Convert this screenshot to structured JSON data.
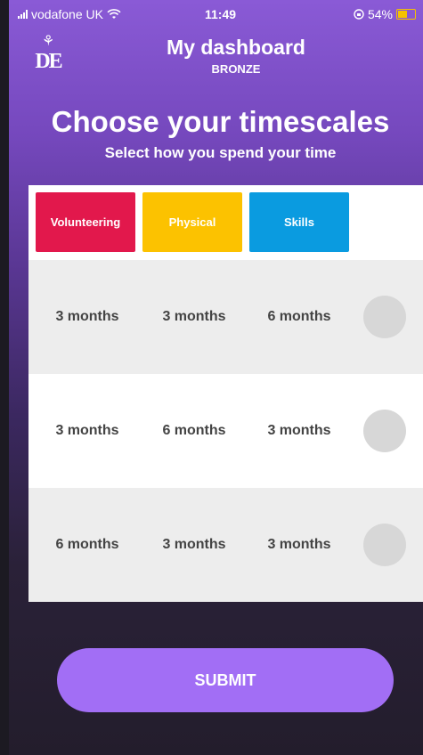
{
  "status_bar": {
    "carrier": "vodafone UK",
    "time": "11:49",
    "battery": "54%",
    "icons": [
      "signal-icon",
      "wifi-icon",
      "orientation-lock-icon",
      "battery-icon"
    ]
  },
  "header": {
    "logo_text": "DE",
    "title": "My dashboard",
    "level": "BRONZE"
  },
  "page": {
    "title": "Choose your timescales",
    "subtitle": "Select how you spend your time"
  },
  "sections": [
    {
      "label": "Volunteering",
      "color": "#e2184c"
    },
    {
      "label": "Physical",
      "color": "#fcc200"
    },
    {
      "label": "Skills",
      "color": "#0a9be0"
    }
  ],
  "options": [
    {
      "values": [
        "3 months",
        "3 months",
        "6 months"
      ],
      "selected": false
    },
    {
      "values": [
        "3 months",
        "6 months",
        "3 months"
      ],
      "selected": false
    },
    {
      "values": [
        "6 months",
        "3 months",
        "3 months"
      ],
      "selected": false
    }
  ],
  "submit_label": "SUBMIT",
  "colors": {
    "accent": "#a26ef5",
    "background_top": "#8a5ad6",
    "background_bottom": "#231d2c"
  }
}
